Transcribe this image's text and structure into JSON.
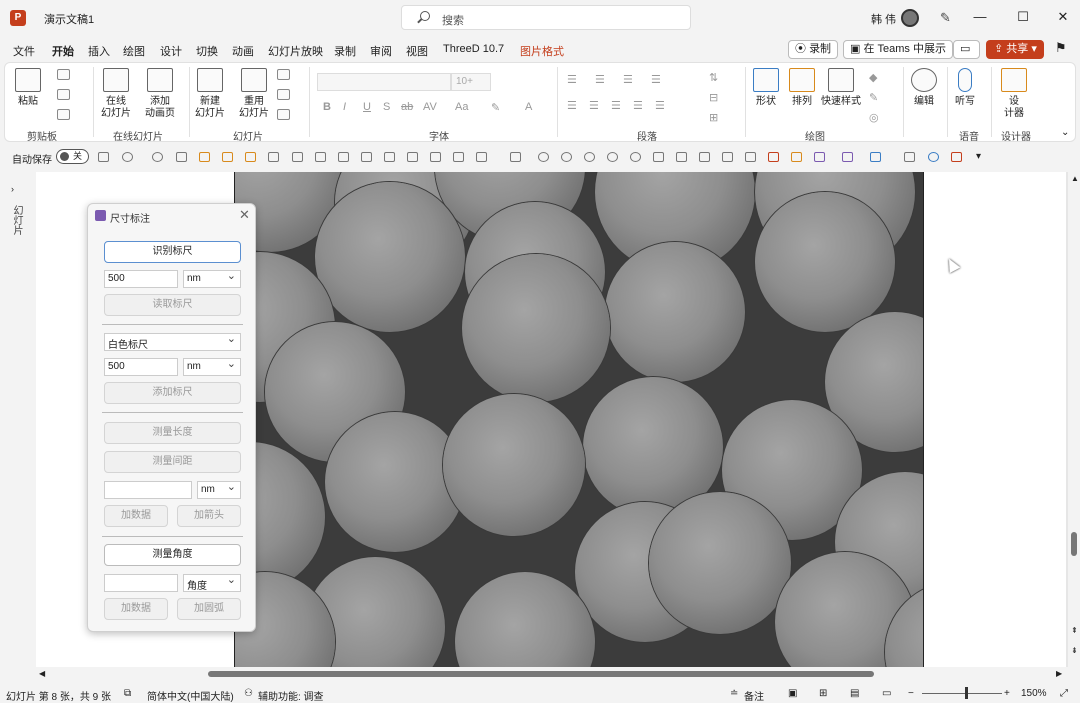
{
  "app": {
    "logo": "P",
    "doc_title": "演示文稿1",
    "search_placeholder": "搜索",
    "user_name": "韩 伟"
  },
  "window_controls": {
    "minimize": "—",
    "maximize": "☐",
    "close": "✕"
  },
  "tabs": [
    "文件",
    "开始",
    "插入",
    "绘图",
    "设计",
    "切换",
    "动画",
    "幻灯片放映",
    "录制",
    "审阅",
    "视图",
    "ThreeD 10.7",
    "图片格式"
  ],
  "active_tab": "开始",
  "context_tab": "图片格式",
  "toolbar_right": {
    "record": "录制",
    "teams": "在 Teams 中展示",
    "share": "共享"
  },
  "ribbon": {
    "groups": [
      "剪贴板",
      "幻灯片",
      "字体",
      "段落",
      "绘图",
      "语音",
      "设计器"
    ],
    "paste": "粘贴",
    "reuse": "重用\n幻灯片",
    "new_slide": "新建\n幻灯片",
    "online_slides": "在线\n幻灯片",
    "add_animation": "添加\n动画页",
    "online_slides_group": "在线幻灯片",
    "shapes": "形状",
    "arrange": "排列",
    "quick_styles": "快速样式",
    "edit": "编辑",
    "dictate": "听写",
    "designer": "设\n计器",
    "font_size": "10+"
  },
  "qat": {
    "autosave": "自动保存",
    "toggle": "关"
  },
  "left_rail": "幻灯片",
  "panel": {
    "title": "尺寸标注",
    "select_scale": "识别标尺",
    "value1": "500",
    "unit1": "nm",
    "read_scale": "读取标尺",
    "scale_type": "白色标尺",
    "value2": "500",
    "unit2": "nm",
    "add_scale": "添加标尺",
    "measure_length": "测量长度",
    "measure_spacing": "测量间距",
    "value3": "",
    "unit3": "nm",
    "add_data": "加数据",
    "add_arrow": "加箭头",
    "measure_angle": "测量角度",
    "value4": "",
    "unit4": "角度",
    "add_data2": "加数据",
    "add_arc": "加圆弧"
  },
  "status": {
    "slide_info": "幻灯片 第 8 张，共 9 张",
    "language": "简体中文(中国大陆)",
    "accessibility": "辅助功能: 调查",
    "notes": "备注",
    "zoom": "150%"
  },
  "colors": {
    "accent": "#c43e1c",
    "panel_border": "#5b8fd0"
  }
}
